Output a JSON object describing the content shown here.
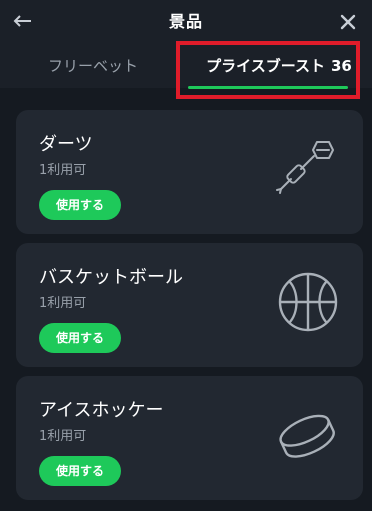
{
  "header": {
    "title": "景品"
  },
  "tabs": {
    "free_bet": "フリーベット",
    "price_boost": "プライスブースト",
    "price_boost_count": "36"
  },
  "cards": [
    {
      "name": "ダーツ",
      "availability": "1利用可",
      "button": "使用する",
      "icon": "darts-icon"
    },
    {
      "name": "バスケットボール",
      "availability": "1利用可",
      "button": "使用する",
      "icon": "basketball-icon"
    },
    {
      "name": "アイスホッケー",
      "availability": "1利用可",
      "button": "使用する",
      "icon": "hockey-puck-icon"
    }
  ],
  "colors": {
    "background": "#151a21",
    "header": "#1b2028",
    "card": "#222831",
    "accent_green": "#1ec95a",
    "highlight_red": "#e01c2a"
  }
}
